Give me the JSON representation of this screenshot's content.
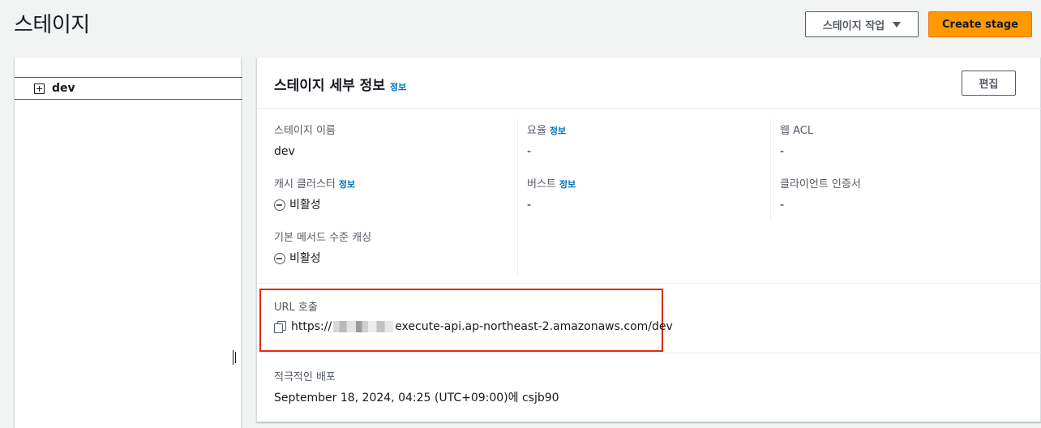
{
  "page": {
    "title": "스테이지"
  },
  "header": {
    "actions_label": "스테이지 작업",
    "create_label": "Create stage"
  },
  "tree": {
    "items": [
      {
        "label": "dev"
      }
    ]
  },
  "details": {
    "title": "스테이지 세부 정보",
    "title_info": "정보",
    "edit_label": "편집",
    "stage_name": {
      "label": "스테이지 이름",
      "value": "dev"
    },
    "cache_cluster": {
      "label": "캐시 클러스터",
      "info": "정보",
      "value": "비활성"
    },
    "method_caching": {
      "label": "기본 메서드 수준 캐싱",
      "value": "비활성"
    },
    "rate": {
      "label": "요율",
      "info": "정보",
      "value": "-"
    },
    "burst": {
      "label": "버스트",
      "info": "정보",
      "value": "-"
    },
    "web_acl": {
      "label": "웹 ACL",
      "value": "-"
    },
    "client_cert": {
      "label": "클라이언트 인증서",
      "value": "-"
    },
    "invoke_url": {
      "label": "URL 호출",
      "prefix": "https://",
      "suffix": "execute-api.ap-northeast-2.amazonaws.com/dev"
    },
    "active_deployment": {
      "label": "적극적인 배포",
      "value": "September 18, 2024, 04:25 (UTC+09:00)에 csjb90"
    }
  },
  "colors": {
    "accent": "#ff9900",
    "link": "#0073bb",
    "highlight": "#e02a10",
    "selected": "#0073bb"
  }
}
